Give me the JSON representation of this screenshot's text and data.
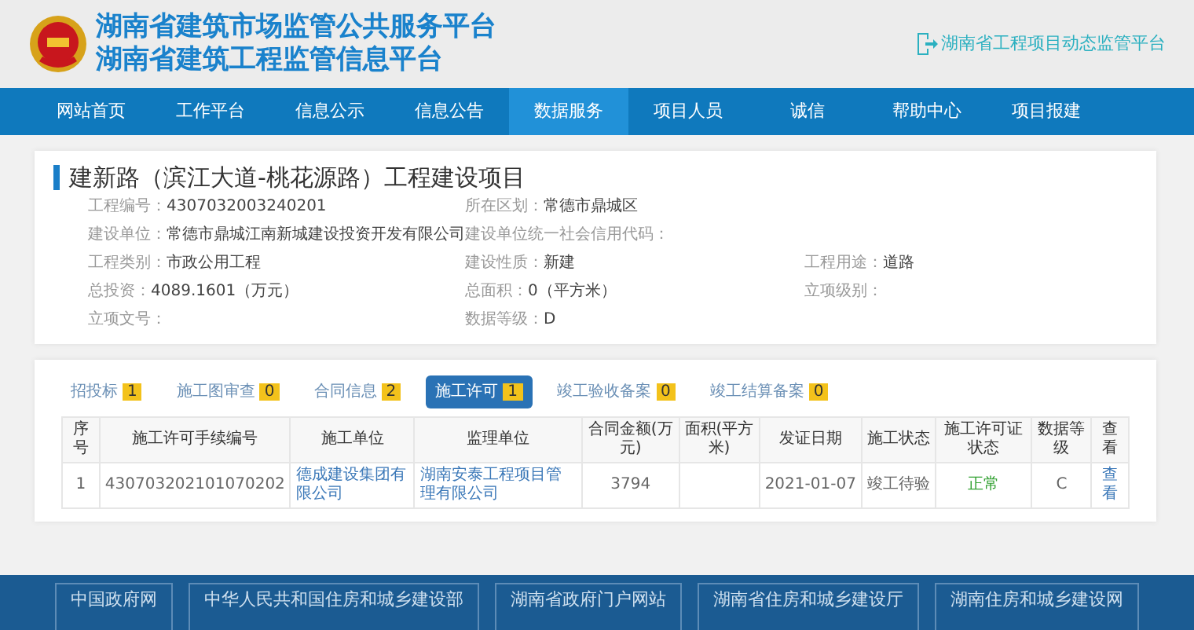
{
  "header": {
    "titles": [
      "湖南省建筑市场监管公共服务平台",
      "湖南省建筑工程监管信息平台"
    ],
    "link": "湖南省工程项目动态监管平台"
  },
  "nav": [
    {
      "label": "网站首页",
      "selected": false
    },
    {
      "label": "工作平台",
      "selected": false
    },
    {
      "label": "信息公示",
      "selected": false
    },
    {
      "label": "信息公告",
      "selected": false
    },
    {
      "label": "数据服务",
      "selected": true
    },
    {
      "label": "项目人员",
      "selected": false
    },
    {
      "label": "诚信",
      "selected": false
    },
    {
      "label": "帮助中心",
      "selected": false
    },
    {
      "label": "项目报建",
      "selected": false
    }
  ],
  "project": {
    "title": "建新路（滨江大道-桃花源路）工程建设项目",
    "rows": [
      [
        {
          "label": "工程编号：",
          "value": "4307032003240201"
        },
        {
          "label": "所在区划：",
          "value": "常德市鼎城区"
        }
      ],
      [
        {
          "label": "建设单位：",
          "value": "常德市鼎城江南新城建设投资开发有限公司"
        },
        {
          "label": "建设单位统一社会信用代码："
        }
      ],
      [
        {
          "label": "工程类别：",
          "value": "市政公用工程"
        },
        {
          "label": "建设性质：",
          "value": "新建"
        },
        {
          "label": "工程用途：",
          "value": "道路"
        }
      ],
      [
        {
          "label": "总投资：",
          "value": "4089.1601（万元）"
        },
        {
          "label": "总面积：",
          "value": "0（平方米）"
        },
        {
          "label": "立项级别："
        }
      ],
      [
        {
          "label": "立项文号："
        },
        {
          "label": "数据等级：",
          "value": "D"
        }
      ]
    ]
  },
  "tabs": [
    {
      "label": "招投标",
      "count": "1",
      "selected": false
    },
    {
      "label": "施工图审查",
      "count": "0",
      "selected": false
    },
    {
      "label": "合同信息",
      "count": "2",
      "selected": false
    },
    {
      "label": "施工许可",
      "count": "1",
      "selected": true
    },
    {
      "label": "竣工验收备案",
      "count": "0",
      "selected": false
    },
    {
      "label": "竣工结算备案",
      "count": "0",
      "selected": false
    }
  ],
  "table": {
    "columns": [
      "序号",
      "施工许可手续编号",
      "施工单位",
      "监理单位",
      "合同金额(万元)",
      "面积(平方米)",
      "发证日期",
      "施工状态",
      "施工许可证状态",
      "数据等级",
      "查看"
    ],
    "rows": [
      [
        {
          "kind": "text",
          "text": "1"
        },
        {
          "kind": "text",
          "text": "430703202101070202"
        },
        {
          "kind": "link",
          "text": "德成建设集团有限公司"
        },
        {
          "kind": "link",
          "text": "湖南安泰工程项目管理有限公司"
        },
        {
          "kind": "text",
          "text": "3794"
        },
        {
          "kind": "empty"
        },
        {
          "kind": "text",
          "text": "2021-01-07"
        },
        {
          "kind": "text",
          "text": "竣工待验"
        },
        {
          "kind": "status",
          "text": "正常"
        },
        {
          "kind": "text",
          "text": "C"
        },
        {
          "kind": "link",
          "text": "查看"
        }
      ]
    ]
  },
  "footer": [
    "中国政府网",
    "中华人民共和国住房和城乡建设部",
    "湖南省政府门户网站",
    "湖南省住房和城乡建设厅",
    "湖南住房和城乡建设网"
  ]
}
